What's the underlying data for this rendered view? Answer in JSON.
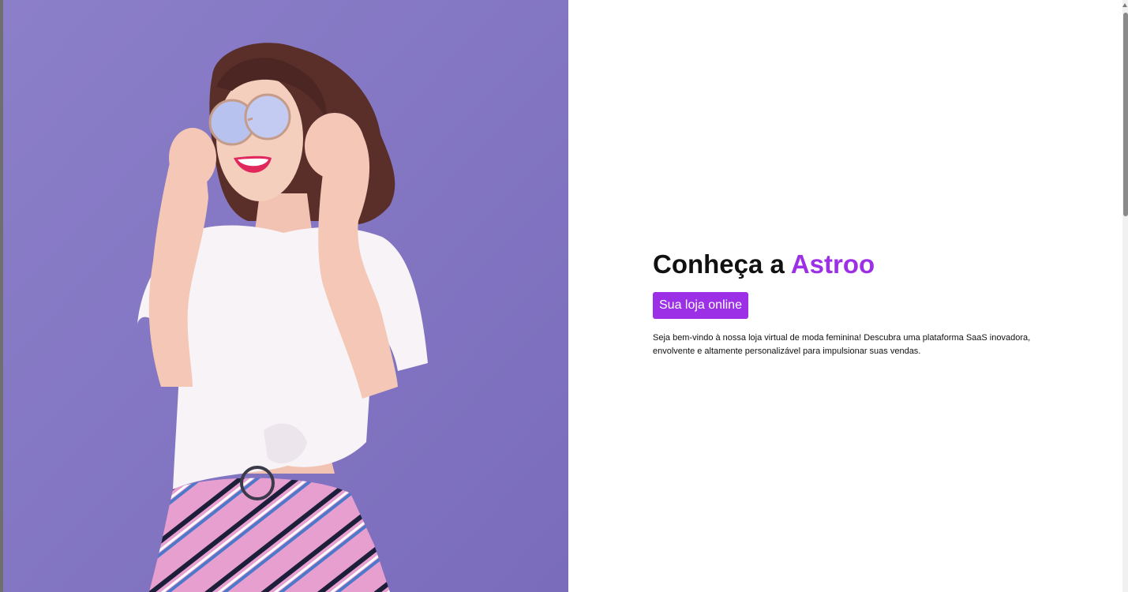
{
  "hero": {
    "heading_prefix": "Conheça a",
    "heading_brand": "Astroo",
    "cta_label": "Sua loja online",
    "description": "Seja bem-vindo à nossa loja virtual de moda feminina! Descubra uma plataforma SaaS inovadora, envolvente e altamente personalizável para impulsionar suas vendas."
  },
  "colors": {
    "brand_purple": "#9b30e6",
    "image_background": "#8679c4"
  }
}
